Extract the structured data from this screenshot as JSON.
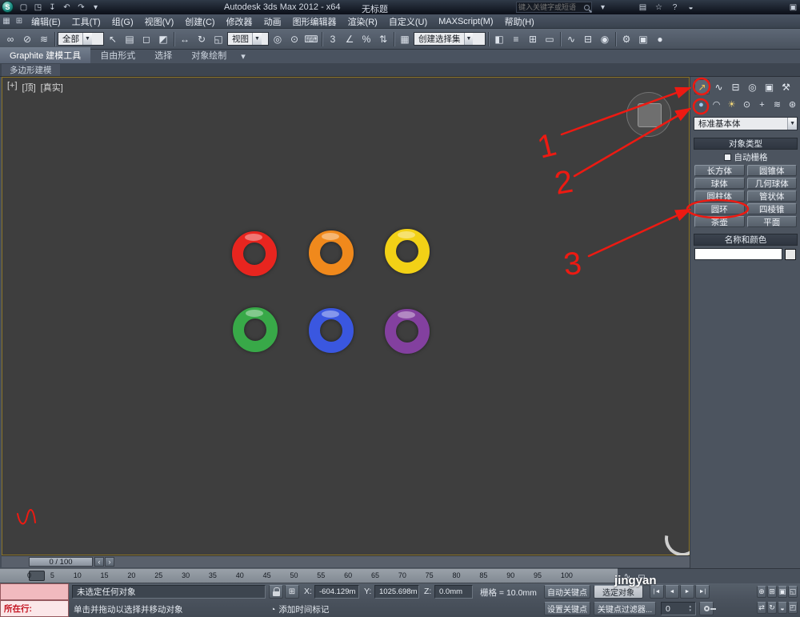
{
  "titlebar": {
    "app_title": "Autodesk 3ds Max 2012 - x64",
    "doc_title": "无标题",
    "search_placeholder": "键入关键字或短语"
  },
  "menubar": {
    "items": [
      {
        "label": "编辑(E)"
      },
      {
        "label": "工具(T)"
      },
      {
        "label": "组(G)"
      },
      {
        "label": "视图(V)"
      },
      {
        "label": "创建(C)"
      },
      {
        "label": "修改器"
      },
      {
        "label": "动画"
      },
      {
        "label": "图形编辑器"
      },
      {
        "label": "渲染(R)"
      },
      {
        "label": "自定义(U)"
      },
      {
        "label": "MAXScript(M)"
      },
      {
        "label": "帮助(H)"
      }
    ]
  },
  "toolbar": {
    "selection_filter_value": "全部",
    "coord_system_value": "视图",
    "named_sets_value": "创建选择集",
    "snap_value": "3"
  },
  "ribbon": {
    "tab_graphite": "Graphite 建模工具",
    "tab_freeform": "自由形式",
    "tab_selection": "选择",
    "tab_object_paint": "对象绘制",
    "subtab_poly": "多边形建模"
  },
  "viewport": {
    "menu_general": "[+]",
    "menu_pov": "[顶]",
    "menu_shading": "[真实]"
  },
  "rings": {
    "red": "#e8251f",
    "orange": "#f0891c",
    "yellow": "#f2d116",
    "green": "#38a948",
    "blue": "#3a57e0",
    "purple": "#83409f"
  },
  "annotations": {
    "step1": "1",
    "step2": "2",
    "step3": "3",
    "color": "#ed1a12"
  },
  "command_panel": {
    "dropdown_value": "标准基本体",
    "rollout_object_type": "对象类型",
    "autogrid_label": "自动栅格",
    "buttons": [
      "长方体",
      "圆锥体",
      "球体",
      "几何球体",
      "圆柱体",
      "管状体",
      "圆环",
      "四棱锥",
      "茶壶",
      "平面"
    ],
    "rollout_name_color": "名称和颜色",
    "name_value": ""
  },
  "timeline": {
    "slider_label": "0 / 100"
  },
  "ruler": {
    "ticks": [
      "0",
      "5",
      "10",
      "15",
      "20",
      "25",
      "30",
      "35",
      "40",
      "45",
      "50",
      "55",
      "60",
      "65",
      "70",
      "75",
      "80",
      "85",
      "90",
      "95",
      "100"
    ]
  },
  "status": {
    "selection_line": "未选定任何对象",
    "prompt_line": "单击并拖动以选择并移动对象",
    "x_label": "X:",
    "x_value": "-604.129m",
    "y_label": "Y:",
    "y_value": "1025.698m",
    "z_label": "Z:",
    "z_value": "0.0mm",
    "grid_value": "栅格 = 10.0mm",
    "add_time_tag": "添加时间标记",
    "auto_key": "自动关键点",
    "selected_filter": "选定对象",
    "set_key": "设置关键点",
    "key_filters": "关键点过滤器...",
    "listener_label": "所在行:",
    "frame_value": "0"
  },
  "watermark": {
    "text": "jingyan"
  },
  "icons": {
    "logo": "S",
    "qat_new": "▢",
    "qat_open": "◳",
    "qat_save": "↧",
    "qat_undo": "↶",
    "qat_redo": "↷",
    "qat_fetch": "▾",
    "tb_comm": "▤",
    "tb_star": "☆",
    "tb_help": "?",
    "tb_info": "◒",
    "tb_panel": "▣",
    "ws_a": "▦",
    "ws_b": "⊞",
    "link": "∞",
    "unlink": "⊘",
    "bind": "≋",
    "select": "↖",
    "select_name": "▤",
    "region": "◻",
    "window": "◩",
    "move": "↔",
    "rotate": "↻",
    "scale": "◱",
    "pivot": "◎",
    "manipulate": "⊙",
    "keyboard": "⌨",
    "angle": "∠",
    "percent": "%",
    "spinner": "⇅",
    "edit_sets": "▦",
    "mirror": "◧",
    "align": "≡",
    "layers": "⊞",
    "ribbon_toggle": "▭",
    "curve": "∿",
    "schematic": "⊟",
    "material": "◉",
    "rsetup": "⚙",
    "rfw": "▣",
    "render": "●",
    "dd_arrow": "▼",
    "small_arrow": "▾",
    "tab_create": "↗",
    "tab_modify": "∿",
    "tab_hier": "⊟",
    "tab_motion": "◎",
    "tab_disp": "▣",
    "tab_util": "⚒",
    "cat_geom": "●",
    "cat_shapes": "◠",
    "cat_lights": "☀",
    "cat_cams": "⊙",
    "cat_help": "+",
    "cat_warps": "≋",
    "cat_sys": "⊛",
    "goto_start": "|◄",
    "prev_frame": "◄",
    "play": "►",
    "goto_end": "►|",
    "nav_zoom": "⊕",
    "nav_zoom_all": "⊞",
    "nav_extents": "▣",
    "nav_region": "◱",
    "nav_pan": "⇄",
    "nav_orbit": "↻",
    "nav_fov": "◒",
    "nav_max": "◰",
    "clock": "◔",
    "abs_mode": "⊞",
    "tick_left": "‹",
    "tick_right": "›",
    "spin_up": "▴",
    "spin_down": "▾"
  }
}
